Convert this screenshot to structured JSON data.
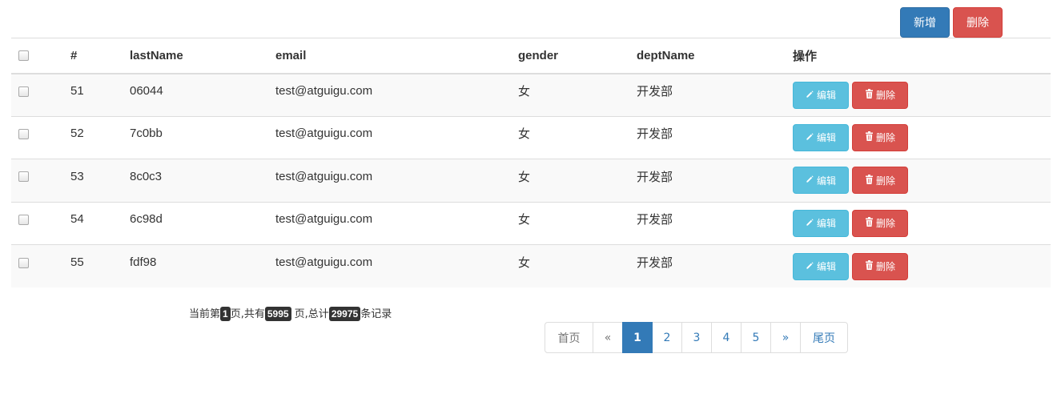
{
  "toolbar": {
    "add_label": "新增",
    "delete_label": "删除"
  },
  "table": {
    "headers": {
      "checkbox": "",
      "id": "#",
      "last_name": "lastName",
      "email": "email",
      "gender": "gender",
      "dept_name": "deptName",
      "actions": "操作"
    },
    "rows": [
      {
        "id": "51",
        "last_name": "06044",
        "email": "test@atguigu.com",
        "gender": "女",
        "dept_name": "开发部",
        "edit_label": "编辑",
        "delete_label": "删除"
      },
      {
        "id": "52",
        "last_name": "7c0bb",
        "email": "test@atguigu.com",
        "gender": "女",
        "dept_name": "开发部",
        "edit_label": "编辑",
        "delete_label": "删除"
      },
      {
        "id": "53",
        "last_name": "8c0c3",
        "email": "test@atguigu.com",
        "gender": "女",
        "dept_name": "开发部",
        "edit_label": "编辑",
        "delete_label": "删除"
      },
      {
        "id": "54",
        "last_name": "6c98d",
        "email": "test@atguigu.com",
        "gender": "女",
        "dept_name": "开发部",
        "edit_label": "编辑",
        "delete_label": "删除"
      },
      {
        "id": "55",
        "last_name": "fdf98",
        "email": "test@atguigu.com",
        "gender": "女",
        "dept_name": "开发部",
        "edit_label": "编辑",
        "delete_label": "删除"
      }
    ]
  },
  "page_info": {
    "prefix": "当前第",
    "current_page": "1",
    "mid1": "页,共有",
    "total_pages": "5995",
    "mid2": " 页,总计",
    "total_records": "29975",
    "suffix": "条记录"
  },
  "pagination": {
    "first_label": "首页",
    "prev_label": "«",
    "pages": [
      "1",
      "2",
      "3",
      "4",
      "5"
    ],
    "active_page": "1",
    "next_label": "»",
    "last_label": "尾页"
  },
  "icons": {
    "edit": "pencil-icon",
    "delete": "trash-icon"
  },
  "colors": {
    "primary": "#337ab7",
    "danger": "#d9534f",
    "info": "#5bc0de",
    "label_bg": "#333333"
  }
}
